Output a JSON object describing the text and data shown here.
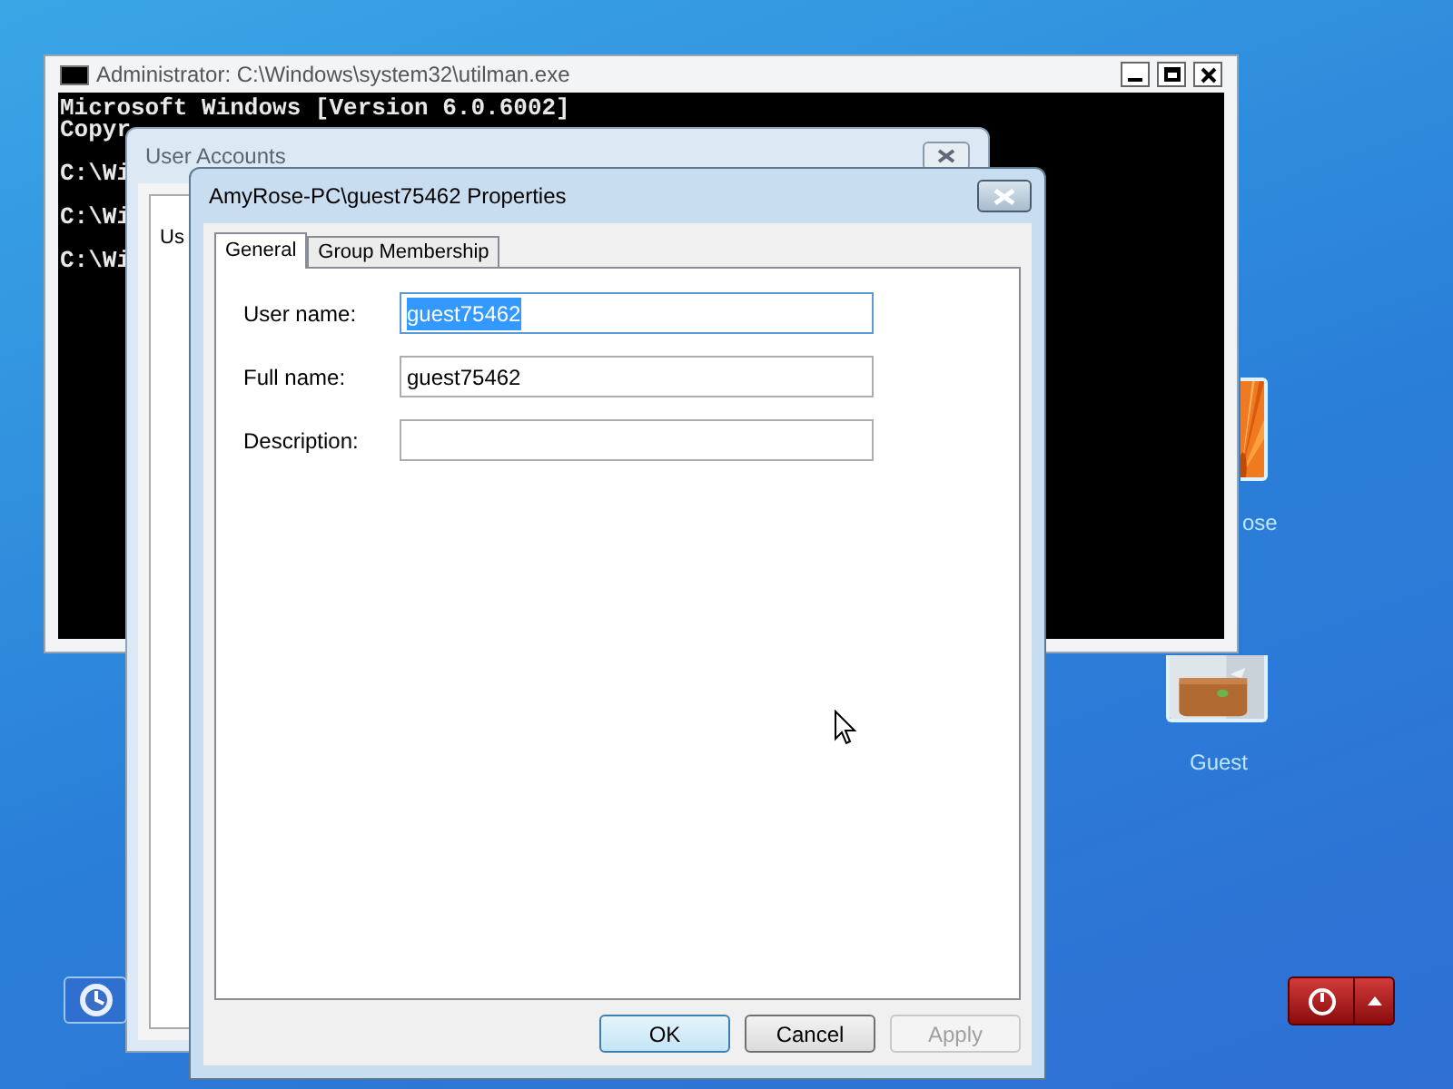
{
  "console_window": {
    "title": "Administrator: C:\\Windows\\system32\\utilman.exe",
    "lines": [
      {
        "kind": "output",
        "text": "Microsoft Windows [Version 6.0.6002]"
      },
      {
        "kind": "output",
        "text": "Copyr"
      },
      {
        "kind": "prompt",
        "text": "C:\\Wi"
      },
      {
        "kind": "prompt",
        "text": "C:\\Wi"
      },
      {
        "kind": "prompt",
        "text": "C:\\Wi"
      }
    ]
  },
  "background_window": {
    "title": "User Accounts",
    "tab": "Us"
  },
  "dialog": {
    "title": "AmyRose-PC\\guest75462 Properties",
    "tabs": [
      {
        "label": "General",
        "selected": true
      },
      {
        "label": "Group Membership",
        "selected": false
      }
    ],
    "fields": [
      {
        "label": "User name:",
        "value": "guest75462",
        "selected": true
      },
      {
        "label": "Full name:",
        "value": "guest75462",
        "selected": false
      },
      {
        "label": "Description:",
        "selected": false
      }
    ],
    "buttons": [
      {
        "label": "OK",
        "default": true,
        "disabled": false
      },
      {
        "label": "Cancel",
        "default": false,
        "disabled": false
      },
      {
        "label": "Apply",
        "default": false,
        "disabled": true
      }
    ]
  },
  "user_tiles": [
    {
      "label": "ose"
    },
    {
      "label": "Guest"
    }
  ]
}
